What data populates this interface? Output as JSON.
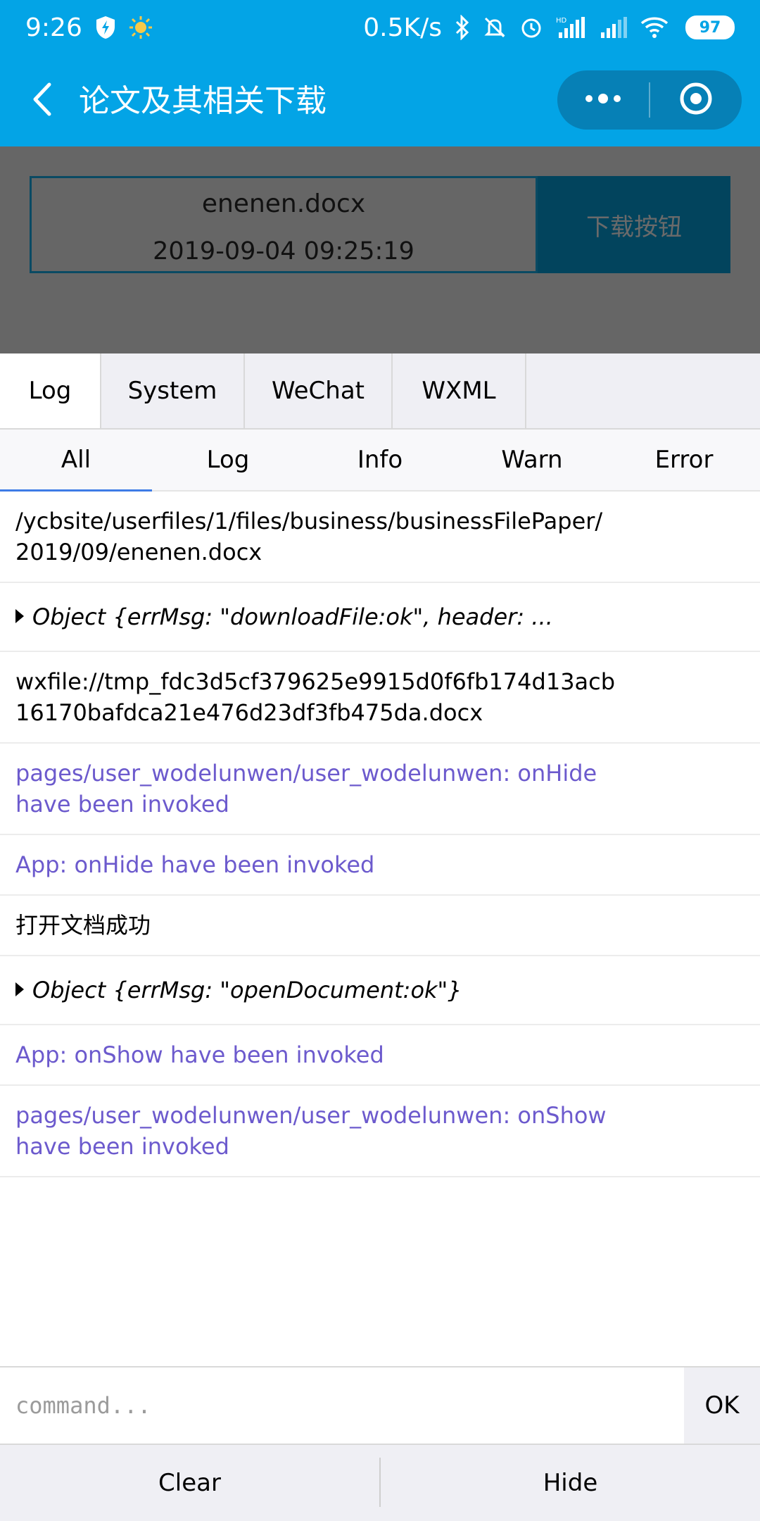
{
  "status_bar": {
    "time": "9:26",
    "speed": "0.5K/s",
    "battery": "97",
    "icons": [
      "shield-flash-icon",
      "sun-icon",
      "bluetooth-icon",
      "bell-off-icon",
      "alarm-icon",
      "hd-signal-icon",
      "signal-icon",
      "wifi-icon",
      "battery-icon"
    ]
  },
  "nav": {
    "title": "论文及其相关下载",
    "icons": [
      "back-arrow-icon",
      "more-dots-icon",
      "target-icon"
    ]
  },
  "page": {
    "file_name": "enenen.docx",
    "file_time": "2019-09-04 09:25:19",
    "download_label": "下载按钮"
  },
  "console": {
    "tabs": [
      "Log",
      "System",
      "WeChat",
      "WXML"
    ],
    "active_tab": "Log",
    "filters": [
      "All",
      "Log",
      "Info",
      "Warn",
      "Error"
    ],
    "active_filter": "All",
    "logs": [
      {
        "type": "log",
        "text": "/ycbsite/userfiles/1/files/business/businessFilePaper/\n2019/09/enenen.docx"
      },
      {
        "type": "object",
        "text": "Object {errMsg: \"downloadFile:ok\", header: ..."
      },
      {
        "type": "log",
        "text": "wxfile://tmp_fdc3d5cf379625e9915d0f6fb174d13acb\n16170bafdca21e476d23df3fb475da.docx"
      },
      {
        "type": "info",
        "text": "pages/user_wodelunwen/user_wodelunwen: onHide\nhave been invoked"
      },
      {
        "type": "info",
        "text": "App: onHide have been invoked"
      },
      {
        "type": "log",
        "text": "打开文档成功"
      },
      {
        "type": "object",
        "text": "Object {errMsg: \"openDocument:ok\"}"
      },
      {
        "type": "info",
        "text": "App: onShow have been invoked"
      },
      {
        "type": "info",
        "text": "pages/user_wodelunwen/user_wodelunwen: onShow\nhave been invoked"
      }
    ],
    "command_placeholder": "command...",
    "ok_label": "OK",
    "clear_label": "Clear",
    "hide_label": "Hide"
  },
  "colors": {
    "header_blue": "#03a4e6",
    "info_text": "#6c5acd",
    "active_underline": "#3e7ce6"
  }
}
